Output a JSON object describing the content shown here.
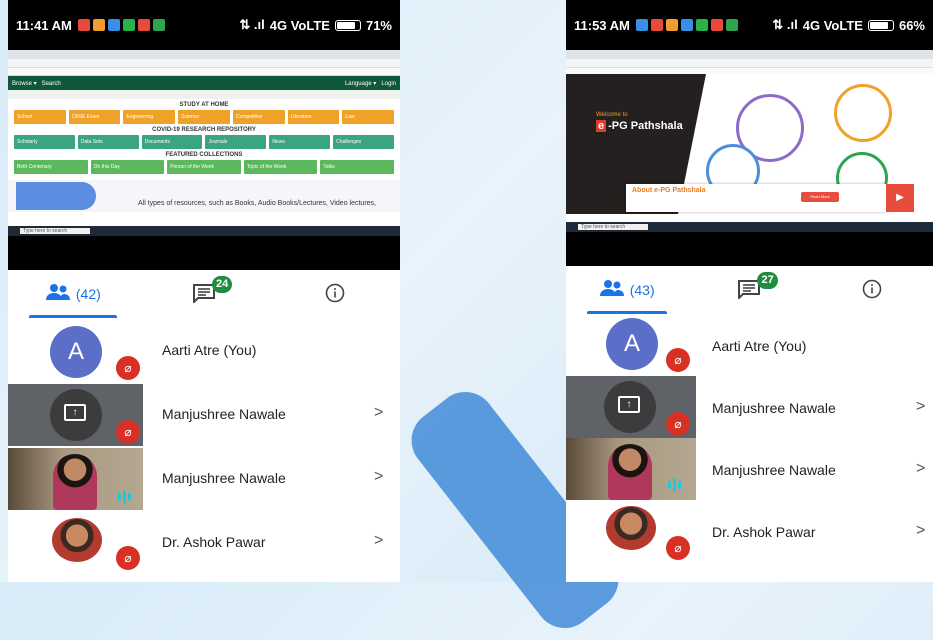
{
  "left": {
    "status": {
      "time": "11:41 AM",
      "network": "4G VoLTE",
      "battery": "71%"
    },
    "site": {
      "section_study": "STUDY AT HOME",
      "section_covid": "COVID-19 RESEARCH REPOSITORY",
      "section_featured": "FEATURED COLLECTIONS",
      "hero_text": "All types of resources, such as Books, Audio Books/Lectures, Video lectures,",
      "taskbar_search": "Type here to search"
    },
    "tabs": {
      "people_count": "(42)",
      "chat_badge": "24"
    },
    "participants": [
      {
        "name": "Aarti Atre (You)",
        "initial": "A"
      },
      {
        "name": "Manjushree Nawale"
      },
      {
        "name": "Manjushree Nawale"
      },
      {
        "name": "Dr. Ashok Pawar"
      }
    ]
  },
  "right": {
    "status": {
      "time": "11:53 AM",
      "network": "4G VoLTE",
      "battery": "66%"
    },
    "site": {
      "welcome": "Welcome to",
      "title_e": "e",
      "title_rest": "-PG Pathshala",
      "about": "About e-PG Pathshala",
      "learn": "Read More",
      "taskbar_search": "Type here to search"
    },
    "tabs": {
      "people_count": "(43)",
      "chat_badge": "27"
    },
    "participants": [
      {
        "name": "Aarti Atre (You)",
        "initial": "A"
      },
      {
        "name": "Manjushree Nawale"
      },
      {
        "name": "Manjushree Nawale"
      },
      {
        "name": "Dr. Ashok Pawar"
      }
    ]
  },
  "icons": {
    "people": "people-icon",
    "chat": "chat-icon",
    "info": "info-icon",
    "mic_off": "mic-off-icon",
    "present": "present-screen-icon",
    "chevron": "chevron-right-icon"
  },
  "colors": {
    "meet_blue": "#1a73e8",
    "badge_green": "#1e8e3e",
    "mic_red": "#d93025",
    "ndl_green": "#10583c"
  }
}
